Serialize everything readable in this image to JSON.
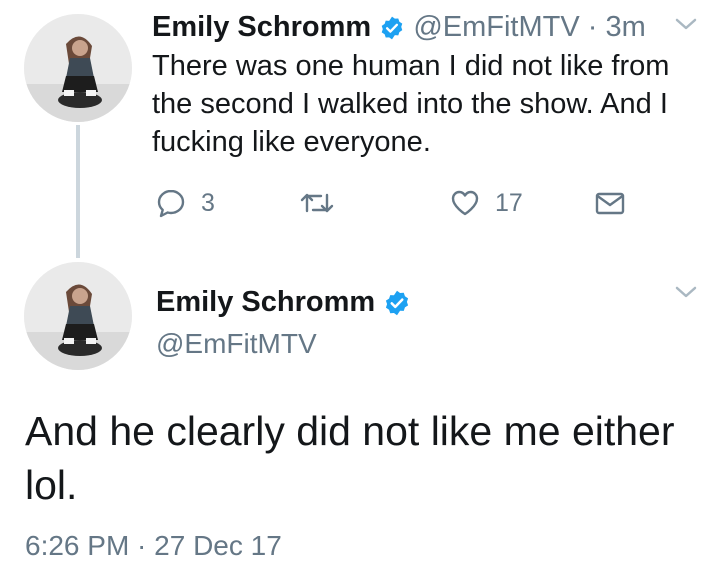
{
  "colors": {
    "verified": "#1da1f2",
    "secondary_text": "#657786",
    "primary_text": "#14171a",
    "thread_line": "#ccd6dd"
  },
  "tweet1": {
    "name": "Emily Schromm",
    "handle": "@EmFitMTV",
    "separator": "·",
    "time": "3m",
    "text": "There was one human I did not like from the second I walked into the show. And I fucking like everyone.",
    "replies": "3",
    "likes": "17",
    "icons": [
      "reply-icon",
      "retweet-icon",
      "like-icon",
      "dm-icon",
      "chevron-down-icon",
      "verified-badge-icon"
    ]
  },
  "tweet2": {
    "name": "Emily Schromm",
    "handle": "@EmFitMTV",
    "text": "And he clearly did not like me either lol.",
    "timestamp": "6:26 PM · 27 Dec 17"
  }
}
